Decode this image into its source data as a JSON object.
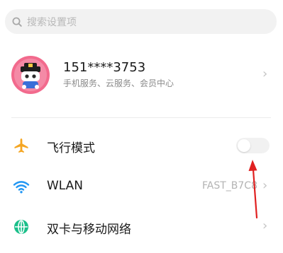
{
  "search": {
    "placeholder": "搜索设置项",
    "icon": "search-icon"
  },
  "profile": {
    "phone": "151****3753",
    "subtitle": "手机服务、云服务、会员中心"
  },
  "settings": [
    {
      "label": "飞行模式",
      "icon": "airplane-icon",
      "control": "toggle",
      "toggle_on": false,
      "icon_color": "#f5a623"
    },
    {
      "label": "WLAN",
      "icon": "wifi-icon",
      "value": "FAST_B7C8",
      "icon_color": "#2196f3"
    },
    {
      "label": "双卡与移动网络",
      "icon": "globe-icon",
      "icon_color": "#1bbf8a"
    }
  ],
  "colors": {
    "annotation_arrow": "#e02020"
  }
}
